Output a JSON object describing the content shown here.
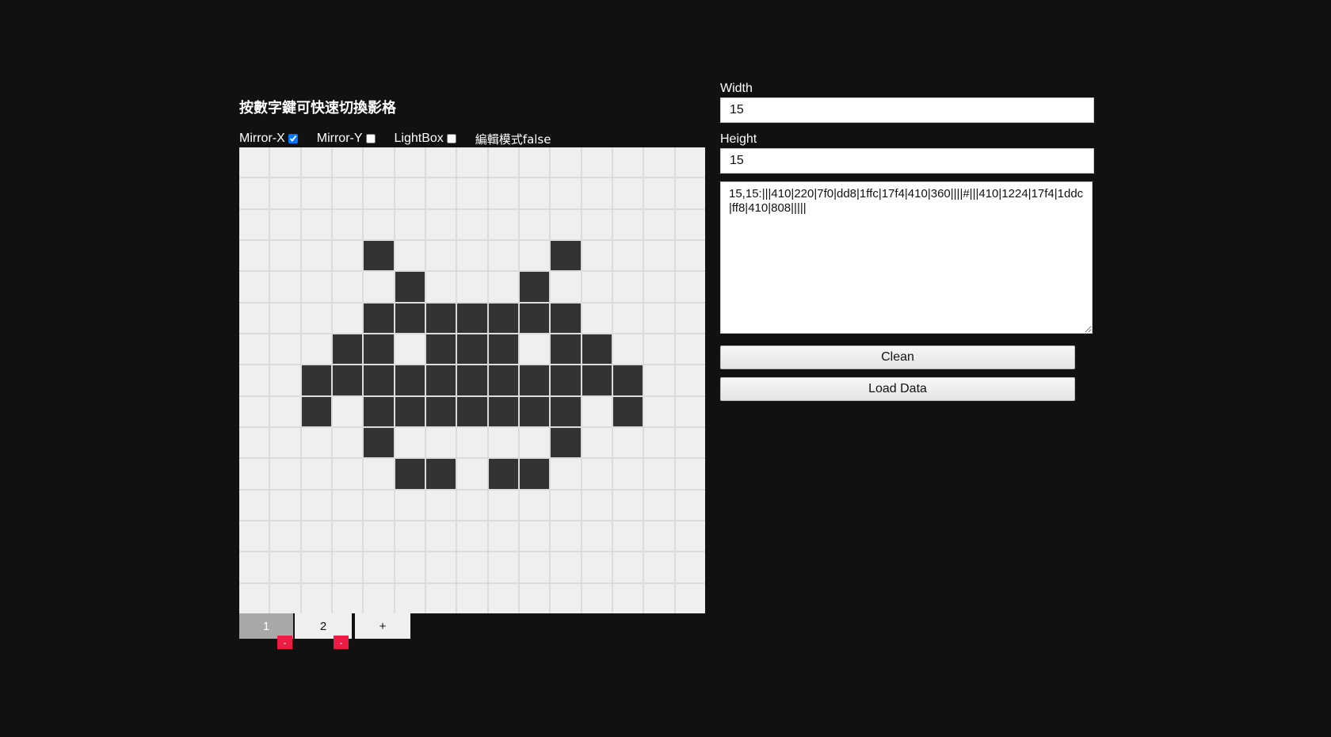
{
  "editor": {
    "title": "按數字鍵可快速切換影格",
    "mirror_x_label": "Mirror-X",
    "mirror_x_checked": true,
    "mirror_y_label": "Mirror-Y",
    "mirror_y_checked": false,
    "lightbox_label": "LightBox",
    "lightbox_checked": false,
    "edit_mode_label": "編輯模式false"
  },
  "grid": {
    "width": 15,
    "height": 15,
    "filled_color": "#333333",
    "empty_color": "#efefef",
    "rows": [
      "000000000000000",
      "000000000000000",
      "000000000000000",
      "000010000010000",
      "000001000100000",
      "000011111110000",
      "000110111011000",
      "001111111111100",
      "001011111110100",
      "000010000010000",
      "000001101100000",
      "000000000000000",
      "000000000000000",
      "000000000000000",
      "000000000000000"
    ]
  },
  "frames": {
    "items": [
      {
        "label": "1",
        "active": true,
        "delete_label": "-"
      },
      {
        "label": "2",
        "active": false,
        "delete_label": "-"
      }
    ],
    "add_label": "+"
  },
  "panel": {
    "width_label": "Width",
    "width_value": "15",
    "height_label": "Height",
    "height_value": "15",
    "data_text": "15,15:|||410|220|7f0|dd8|1ffc|17f4|410|360||||#|||410|1224|17f4|1ddc|ff8|410|808|||||",
    "clean_label": "Clean",
    "load_label": "Load Data"
  },
  "colors": {
    "background": "#111111",
    "delete_accent": "#ee1c44",
    "active_frame": "#a8a8a8"
  }
}
